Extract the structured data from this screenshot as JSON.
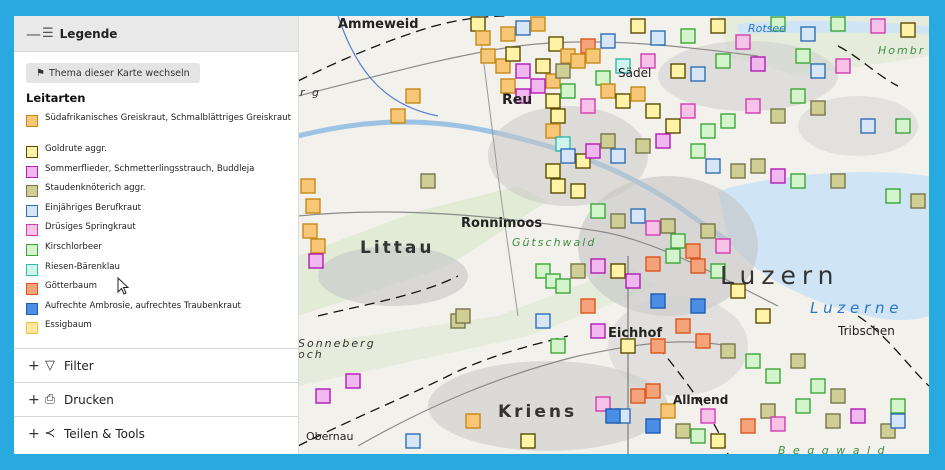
{
  "panel": {
    "legend": {
      "toggle": "—",
      "title": "Legende",
      "switch_button": "Thema dieser Karte wechseln",
      "heading": "Leitarten",
      "items": [
        {
          "label": "Südafrikanisches Greiskraut, Schmalblättriges Greiskraut",
          "fill": "#f7c777",
          "stroke": "#c48a1b"
        },
        {
          "label": "Goldrute aggr.",
          "fill": "#fff3a8",
          "stroke": "#5a4b00"
        },
        {
          "label": "Sommerflieder, Schmetterlingsstrauch, Buddleja",
          "fill": "#f0b8ee",
          "stroke": "#b21ab5"
        },
        {
          "label": "Staudenknöterich aggr.",
          "fill": "#cfcf95",
          "stroke": "#76764a"
        },
        {
          "label": "Einjähriges Berufkraut",
          "fill": "#d6e6f7",
          "stroke": "#2f6fb5"
        },
        {
          "label": "Drüsiges Springkraut",
          "fill": "#f6c2e8",
          "stroke": "#d23cb0"
        },
        {
          "label": "Kirschlorbeer",
          "fill": "#d4f4cc",
          "stroke": "#3ea63a"
        },
        {
          "label": "Riesen-Bärenklau",
          "fill": "#cff5ee",
          "stroke": "#34b7a4"
        },
        {
          "label": "Götterbaum",
          "fill": "#f5a37a",
          "stroke": "#d9561c"
        },
        {
          "label": "Aufrechte Ambrosie, aufrechtes Traubenkraut",
          "fill": "#4a8ee6",
          "stroke": "#1d5cb3"
        },
        {
          "label": "Essigbaum",
          "fill": "#ffe6a3",
          "stroke": "#f0c040"
        }
      ]
    },
    "sections": [
      {
        "toggle": "+",
        "icon": "filter-icon",
        "label": "Filter"
      },
      {
        "toggle": "+",
        "icon": "printer-icon",
        "label": "Drucken"
      },
      {
        "toggle": "+",
        "icon": "share-icon",
        "label": "Teilen & Tools"
      }
    ]
  },
  "map": {
    "labels": {
      "ammeweid": "Ammeweid",
      "rotsee": "Rotsee",
      "hombr": "Hombr",
      "saedel": "Sädel",
      "reuss": "Reu",
      "rg": "r g",
      "ronnimoos": "Ronnimoos",
      "guetschwald": "Gütschwald",
      "littau": "Littau",
      "luzern": "Luzern",
      "luzerne": "L u z e r n e",
      "tribschen": "Tribschen",
      "eichhof": "Eichhof",
      "sonneberg": "Sonneberg",
      "och": "och",
      "allmend": "Allmend",
      "kriens": "Kriens",
      "obernau": "Obernau",
      "bgwald": "B e g g w a l d"
    }
  }
}
